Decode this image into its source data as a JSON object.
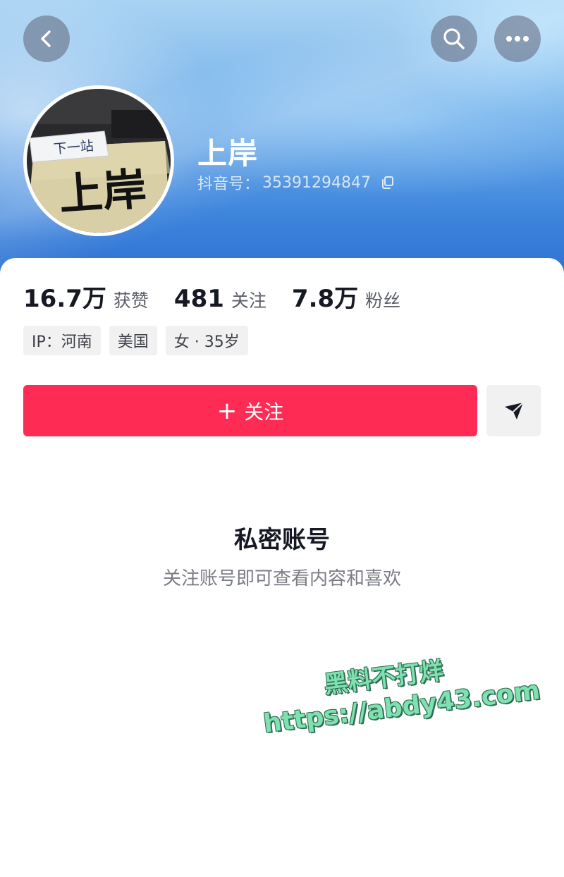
{
  "colors": {
    "accent": "#fe2c55",
    "hero_top": "#a9d3f3",
    "hero_bottom": "#2d70d2",
    "watermark_fill": "#7fe0b0"
  },
  "header": {
    "back_icon": "chevron-left-icon",
    "search_icon": "search-icon",
    "more_icon": "more-horizontal-icon"
  },
  "profile": {
    "avatar_sign_text": "下一站",
    "avatar_main_text": "上岸",
    "nickname": "上岸",
    "id_label": "抖音号：",
    "id_value": "35391294847",
    "copy_icon": "copy-icon"
  },
  "stats": [
    {
      "value": "16.7万",
      "label": "获赞"
    },
    {
      "value": "481",
      "label": "关注"
    },
    {
      "value": "7.8万",
      "label": "粉丝"
    }
  ],
  "tags": [
    "IP：河南",
    "美国",
    "女 · 35岁"
  ],
  "actions": {
    "follow_plus": "+",
    "follow_label": "关注",
    "message_icon": "send-message-icon"
  },
  "private": {
    "title": "私密账号",
    "subtitle": "关注账号即可查看内容和喜欢"
  },
  "watermark": {
    "line1": "黑料不打烊",
    "line2": "https://abdy43.com"
  }
}
